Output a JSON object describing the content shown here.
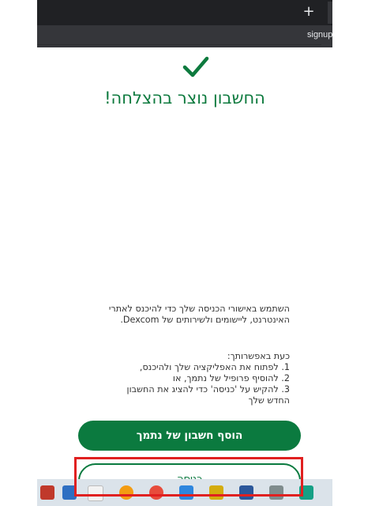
{
  "browser": {
    "new_tab_glyph": "+",
    "tab_title": "signup"
  },
  "page": {
    "title": "החשבון נוצר בהצלחה!",
    "intro_line1": "השתמש באישורי הכניסה שלך כדי להיכנס לאתרי",
    "intro_line2": "האינטרנט, ליישומים ולשירותים של Dexcom.",
    "options_heading": "כעת באפשרותך:",
    "options": [
      "1. לפתוח את האפליקציה שלך ולהיכנס,",
      "2. להוסיף פרופיל של נתמך, או",
      "3. להקיש על 'כניסה' כדי להציג את החשבון",
      "החדש שלך"
    ],
    "add_follower_label": "הוסף חשבון של נתמך",
    "login_label": "כניסה",
    "accent_color": "#0b7a3f",
    "highlight_color": "#e02020"
  },
  "taskbar": {
    "icons": [
      "app-icon-1",
      "app-icon-2",
      "app-icon-3",
      "app-icon-4",
      "chrome-icon",
      "mail-icon",
      "app-icon-7",
      "word-icon",
      "app-icon-9",
      "app-icon-10"
    ]
  }
}
